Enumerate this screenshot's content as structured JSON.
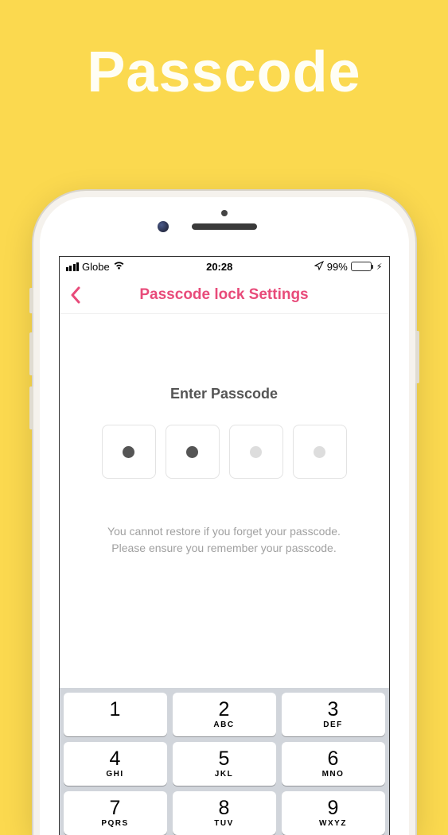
{
  "promo": {
    "title": "Passcode"
  },
  "statusBar": {
    "carrier": "Globe",
    "time": "20:28",
    "batteryPercent": "99%"
  },
  "nav": {
    "title": "Passcode lock Settings"
  },
  "content": {
    "prompt": "Enter Passcode",
    "hintLine1": "You cannot restore if you forget your passcode.",
    "hintLine2": "Please ensure you remember your passcode."
  },
  "passcode": {
    "digitsEntered": 2,
    "totalDigits": 4,
    "colors": {
      "filled": "#555",
      "empty": "#ddd"
    }
  },
  "keypad": {
    "keys": [
      {
        "num": "1",
        "letters": ""
      },
      {
        "num": "2",
        "letters": "ABC"
      },
      {
        "num": "3",
        "letters": "DEF"
      },
      {
        "num": "4",
        "letters": "GHI"
      },
      {
        "num": "5",
        "letters": "JKL"
      },
      {
        "num": "6",
        "letters": "MNO"
      },
      {
        "num": "7",
        "letters": "PQRS"
      },
      {
        "num": "8",
        "letters": "TUV"
      },
      {
        "num": "9",
        "letters": "WXYZ"
      }
    ]
  }
}
